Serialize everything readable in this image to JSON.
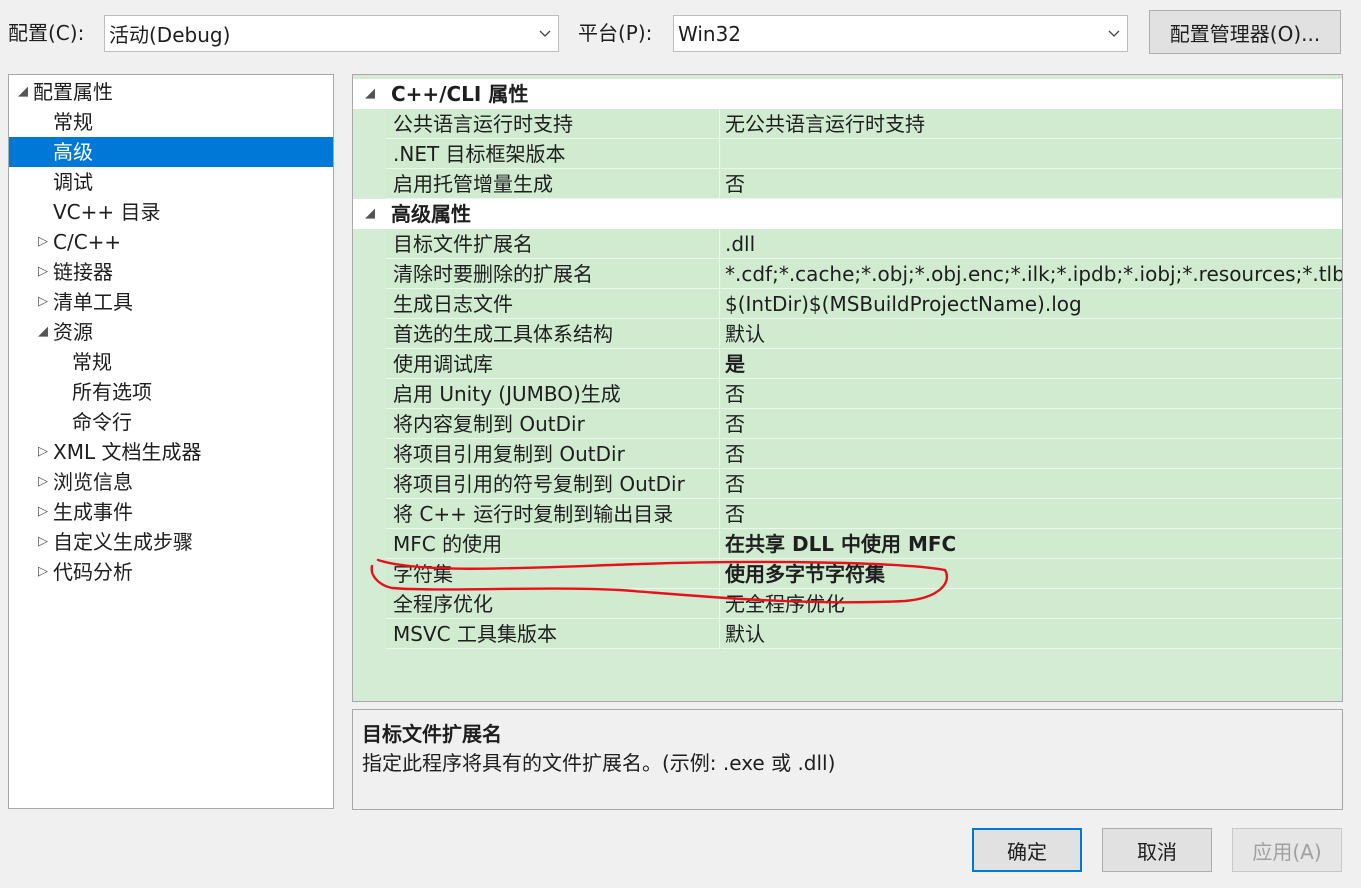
{
  "config_label": "配置(C):",
  "config_value": "活动(Debug)",
  "platform_label": "平台(P):",
  "platform_value": "Win32",
  "config_manager_label": "配置管理器(O)...",
  "tree": [
    {
      "label": "配置属性",
      "toggle": "◢",
      "level": 0,
      "selected": false
    },
    {
      "label": "常规",
      "toggle": "",
      "level": 1,
      "selected": false
    },
    {
      "label": "高级",
      "toggle": "",
      "level": 1,
      "selected": true
    },
    {
      "label": "调试",
      "toggle": "",
      "level": 1,
      "selected": false
    },
    {
      "label": "VC++ 目录",
      "toggle": "",
      "level": 1,
      "selected": false
    },
    {
      "label": "C/C++",
      "toggle": "▷",
      "level": 1,
      "selected": false
    },
    {
      "label": "链接器",
      "toggle": "▷",
      "level": 1,
      "selected": false
    },
    {
      "label": "清单工具",
      "toggle": "▷",
      "level": 1,
      "selected": false
    },
    {
      "label": "资源",
      "toggle": "◢",
      "level": 1,
      "selected": false
    },
    {
      "label": "常规",
      "toggle": "",
      "level": 2,
      "selected": false
    },
    {
      "label": "所有选项",
      "toggle": "",
      "level": 2,
      "selected": false
    },
    {
      "label": "命令行",
      "toggle": "",
      "level": 2,
      "selected": false
    },
    {
      "label": "XML 文档生成器",
      "toggle": "▷",
      "level": 1,
      "selected": false
    },
    {
      "label": "浏览信息",
      "toggle": "▷",
      "level": 1,
      "selected": false
    },
    {
      "label": "生成事件",
      "toggle": "▷",
      "level": 1,
      "selected": false
    },
    {
      "label": "自定义生成步骤",
      "toggle": "▷",
      "level": 1,
      "selected": false
    },
    {
      "label": "代码分析",
      "toggle": "▷",
      "level": 1,
      "selected": false
    }
  ],
  "grid": [
    {
      "type": "category",
      "name": "C++/CLI 属性",
      "toggle": "◢"
    },
    {
      "type": "prop",
      "name": "公共语言运行时支持",
      "value": "无公共语言运行时支持",
      "bold": false
    },
    {
      "type": "prop",
      "name": ".NET 目标框架版本",
      "value": "",
      "bold": false
    },
    {
      "type": "prop",
      "name": "启用托管增量生成",
      "value": "否",
      "bold": false
    },
    {
      "type": "category",
      "name": "高级属性",
      "toggle": "◢"
    },
    {
      "type": "prop",
      "name": "目标文件扩展名",
      "value": ".dll",
      "bold": false
    },
    {
      "type": "prop",
      "name": "清除时要删除的扩展名",
      "value": "*.cdf;*.cache;*.obj;*.obj.enc;*.ilk;*.ipdb;*.iobj;*.resources;*.tlb;*.",
      "bold": false
    },
    {
      "type": "prop",
      "name": "生成日志文件",
      "value": "$(IntDir)$(MSBuildProjectName).log",
      "bold": false
    },
    {
      "type": "prop",
      "name": "首选的生成工具体系结构",
      "value": "默认",
      "bold": false
    },
    {
      "type": "prop",
      "name": "使用调试库",
      "value": "是",
      "bold": true
    },
    {
      "type": "prop",
      "name": "启用 Unity (JUMBO)生成",
      "value": "否",
      "bold": false
    },
    {
      "type": "prop",
      "name": "将内容复制到 OutDir",
      "value": "否",
      "bold": false
    },
    {
      "type": "prop",
      "name": "将项目引用复制到 OutDir",
      "value": "否",
      "bold": false
    },
    {
      "type": "prop",
      "name": "将项目引用的符号复制到 OutDir",
      "value": "否",
      "bold": false
    },
    {
      "type": "prop",
      "name": "将 C++ 运行时复制到输出目录",
      "value": "否",
      "bold": false
    },
    {
      "type": "prop",
      "name": "MFC 的使用",
      "value": "在共享 DLL 中使用 MFC",
      "bold": true
    },
    {
      "type": "prop",
      "name": "字符集",
      "value": "使用多字节字符集",
      "bold": true
    },
    {
      "type": "prop",
      "name": "全程序优化",
      "value": "无全程序优化",
      "bold": false
    },
    {
      "type": "prop",
      "name": "MSVC 工具集版本",
      "value": "默认",
      "bold": false
    }
  ],
  "description": {
    "title": "目标文件扩展名",
    "text": "指定此程序将具有的文件扩展名。(示例: .exe 或 .dll)"
  },
  "buttons": {
    "ok": "确定",
    "cancel": "取消",
    "apply": "应用(A)"
  },
  "colors": {
    "selection": "#0078d7",
    "grid_background": "#d4ecd4",
    "annotation": "#e8101a"
  }
}
